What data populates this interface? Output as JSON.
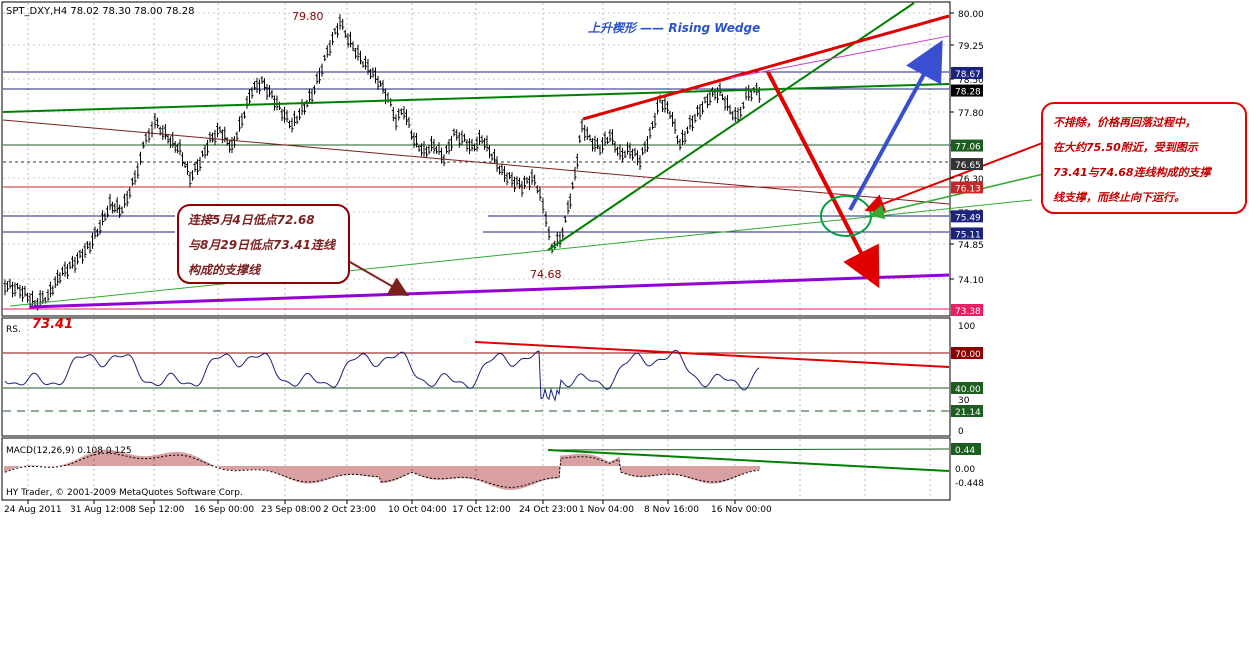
{
  "window": {
    "symbol_header": "SPT_DXY,H4  78.02 78.30 78.00 78.28",
    "watermark": "HY Trader, © 2001-2009 MetaQuotes Software Corp."
  },
  "annotations": {
    "wedge_title": "上升楔形 —— Rising Wedge",
    "high_label": "79.80",
    "low_mid_label": "74.68",
    "low_left_label": "73.41",
    "left_box_lines": [
      "连接5月4日低点72.68",
      "与8月29日低点73.41连线",
      "构成的支撑线"
    ],
    "right_box_lines": [
      "不排除，价格再回落过程中，",
      "在大约75.50附近，受到图示",
      "73.41与74.68连线构成的支撑",
      "线支撑，而终止向下运行。"
    ]
  },
  "price_axis": {
    "ticks": [
      "80.00",
      "79.25",
      "78.50",
      "77.80",
      "77.05",
      "76.30",
      "75.60",
      "74.85",
      "74.10"
    ],
    "tags": [
      {
        "label": "78.67",
        "value": 78.67,
        "color": "#1a237e"
      },
      {
        "label": "78.28",
        "value": 78.28,
        "color": "#000000"
      },
      {
        "label": "77.06",
        "value": 77.06,
        "color": "#1b5e20"
      },
      {
        "label": "76.65",
        "value": 76.65,
        "color": "#333333"
      },
      {
        "label": "76.13",
        "value": 76.13,
        "color": "#c62828"
      },
      {
        "label": "75.49",
        "value": 75.49,
        "color": "#1a237e"
      },
      {
        "label": "75.11",
        "value": 75.11,
        "color": "#1a237e"
      },
      {
        "label": "73.38",
        "value": 73.38,
        "color": "#e91e63"
      }
    ]
  },
  "rsi_panel": {
    "label": "RS.",
    "ticks": [
      "100",
      "30",
      "0"
    ],
    "tags": [
      {
        "label": "70.00",
        "value": 70,
        "color": "#8b0000"
      },
      {
        "label": "40.00",
        "value": 40,
        "color": "#1b5e20"
      },
      {
        "label": "21.14",
        "value": 21.14,
        "color": "#1b5e20"
      }
    ]
  },
  "macd_panel": {
    "label": "MACD(12,26,9) 0.108 0.125",
    "ticks": [
      "0.00",
      "-0.448"
    ],
    "tags": [
      {
        "label": "0.44",
        "value": 0.44,
        "color": "#1b5e20"
      }
    ]
  },
  "time_axis": [
    "24 Aug 2011",
    "31 Aug 12:00",
    "8 Sep 12:00",
    "16 Sep 00:00",
    "23 Sep 08:00",
    "2 Oct 23:00",
    "10 Oct 04:00",
    "17 Oct 12:00",
    "24 Oct 23:00",
    "1 Nov 04:00",
    "8 Nov 16:00",
    "16 Nov 00:00"
  ],
  "colors": {
    "wedge_red": "#e00000",
    "wedge_green": "#008000",
    "support_purple": "#9400d3",
    "arrow_blue": "#3a4fd0",
    "circle_green": "#00a040",
    "box_border": "#8b0000",
    "bar": "#000000"
  },
  "chart_data": {
    "type": "bar",
    "title": "",
    "price_range": [
      73.2,
      80.2
    ],
    "rsi_range": [
      0,
      100
    ],
    "macd_range": [
      -0.6,
      0.55
    ]
  }
}
